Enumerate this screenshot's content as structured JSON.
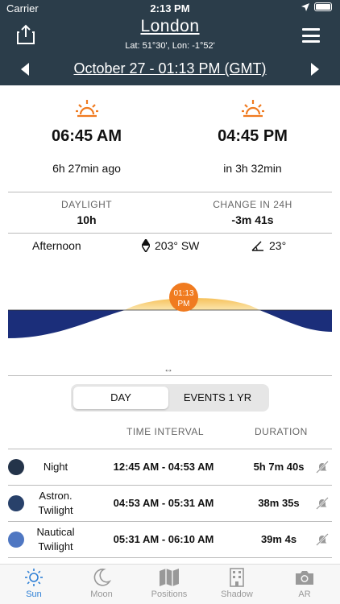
{
  "status_bar": {
    "carrier": "Carrier",
    "time": "2:13 PM"
  },
  "header": {
    "city": "London",
    "coords": "Lat: 51°30', Lon: -1°52'",
    "date": "October 27 - 01:13 PM (GMT)"
  },
  "sunrise": {
    "time": "06:45 AM",
    "relative": "6h 27min ago"
  },
  "sunset": {
    "time": "04:45 PM",
    "relative": "in 3h 32min"
  },
  "daylight": {
    "label": "DAYLIGHT",
    "value": "10h"
  },
  "change": {
    "label": "CHANGE IN 24H",
    "value": "-3m 41s"
  },
  "position": {
    "period": "Afternoon",
    "azimuth": "203° SW",
    "elevation": "23°"
  },
  "graph": {
    "marker_line1": "01:13",
    "marker_line2": "PM"
  },
  "segment": {
    "day": "DAY",
    "events": "EVENTS 1 YR"
  },
  "table": {
    "col_interval": "TIME INTERVAL",
    "col_duration": "DURATION",
    "rows": [
      {
        "name": "Night",
        "interval": "12:45 AM - 04:53 AM",
        "duration": "5h 7m 40s",
        "color": "#24344a"
      },
      {
        "name": "Astron. Twilight",
        "interval": "04:53 AM - 05:31 AM",
        "duration": "38m 35s",
        "color": "#28416a"
      },
      {
        "name": "Nautical Twilight",
        "interval": "05:31 AM - 06:10 AM",
        "duration": "39m 4s",
        "color": "#4f77c2"
      }
    ]
  },
  "tabs": [
    {
      "label": "Sun"
    },
    {
      "label": "Moon"
    },
    {
      "label": "Positions"
    },
    {
      "label": "Shadow"
    },
    {
      "label": "AR"
    }
  ],
  "colors": {
    "header_bg": "#2b3d4a",
    "accent": "#2f80d6",
    "sun_orange": "#f07b20"
  }
}
